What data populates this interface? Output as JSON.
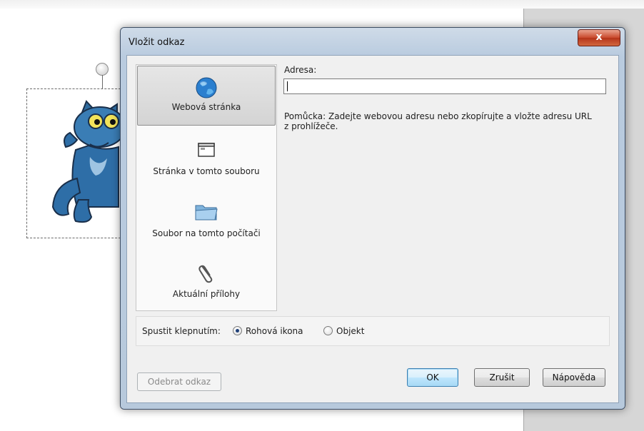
{
  "dialog": {
    "title": "Vložit odkaz",
    "close_label": "x"
  },
  "link_types": [
    {
      "label": "Webová stránka",
      "icon": "globe-icon",
      "selected": true
    },
    {
      "label": "Stránka v tomto souboru",
      "icon": "page-icon",
      "selected": false
    },
    {
      "label": "Soubor na tomto počítači",
      "icon": "folder-icon",
      "selected": false
    },
    {
      "label": "Aktuální přílohy",
      "icon": "paperclip-icon",
      "selected": false
    }
  ],
  "address": {
    "label": "Adresa:",
    "value": "",
    "hint": "Pomůcka: Zadejte webovou adresu nebo zkopírujte a vložte adresu URL z prohlížeče."
  },
  "run_on_click": {
    "label": "Spustit klepnutím:",
    "options": [
      {
        "label": "Rohová ikona",
        "checked": true
      },
      {
        "label": "Objekt",
        "checked": false
      }
    ]
  },
  "buttons": {
    "remove_link": "Odebrat odkaz",
    "ok": "OK",
    "cancel": "Zrušit",
    "help": "Nápověda"
  },
  "colors": {
    "accent": "#3c7fb1",
    "close_button": "#c8492c"
  }
}
